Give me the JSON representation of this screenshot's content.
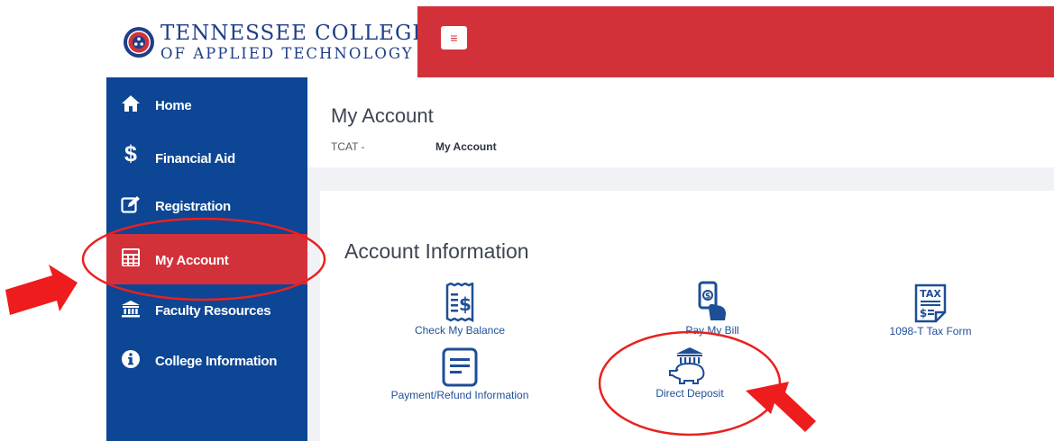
{
  "header": {
    "logo_line1": "TENNESSEE COLLEGES",
    "logo_line2": "OF APPLIED TECHNOLOGY",
    "menu_icon": "hamburger-icon",
    "bar_color": "#d3313a"
  },
  "sidebar": {
    "color": "#0d4694",
    "active_color": "#d3313a",
    "items": [
      {
        "label": "Home",
        "icon": "home-icon"
      },
      {
        "label": "Financial Aid",
        "icon": "dollar-icon"
      },
      {
        "label": "Registration",
        "icon": "edit-icon"
      },
      {
        "label": "My Account",
        "icon": "calculator-icon",
        "active": true
      },
      {
        "label": "Faculty Resources",
        "icon": "institution-icon"
      },
      {
        "label": "College Information",
        "icon": "info-icon"
      }
    ]
  },
  "main": {
    "page_title": "My Account",
    "breadcrumb": {
      "root": "TCAT -",
      "current": "My Account"
    },
    "section_title": "Account Information",
    "tiles": [
      {
        "label": "Check My Balance",
        "icon": "receipt-icon"
      },
      {
        "label": "Pay My Bill",
        "icon": "pay-bill-icon"
      },
      {
        "label": "1098-T Tax Form",
        "icon": "tax-form-icon"
      },
      {
        "label": "Payment/Refund Information",
        "icon": "document-icon"
      },
      {
        "label": "Direct Deposit",
        "icon": "piggy-bank-icon"
      }
    ]
  },
  "annotations": {
    "color": "#ee1c1c",
    "marks": [
      "red-arrow",
      "red-ellipse"
    ]
  }
}
